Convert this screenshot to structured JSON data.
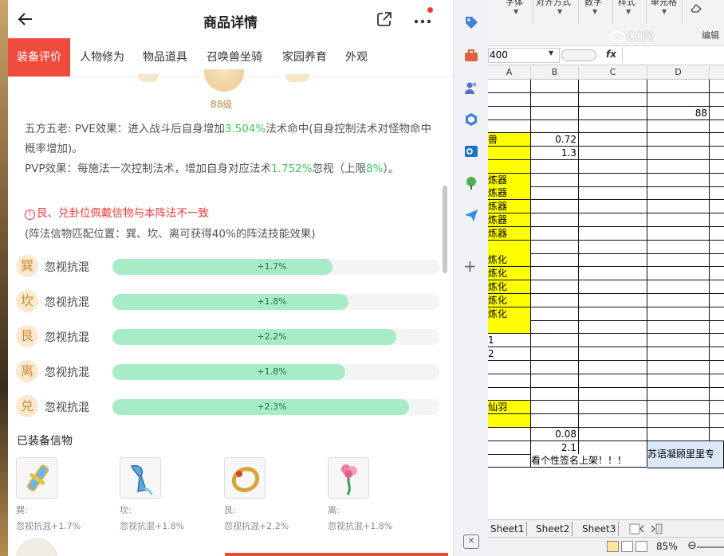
{
  "phone": {
    "title": "商品详情",
    "tabs": [
      {
        "label": "装备评价",
        "active": true
      },
      {
        "label": "人物修为",
        "active": false
      },
      {
        "label": "物品道具",
        "active": false
      },
      {
        "label": "召唤兽坐骑",
        "active": false
      },
      {
        "label": "家园养育",
        "active": false
      },
      {
        "label": "外观",
        "active": false
      }
    ],
    "level": "88级",
    "desc": {
      "line1_pre": "五方五老: PVE效果：进入战斗后自身增加",
      "line1_val": "3.504%",
      "line1_post": "法术命中(自身控制法术对怪物命中概率增加)。",
      "line2_pre": "PVP效果：每施法一次控制法术，增加自身对应法术",
      "line2_val": "1.752%",
      "line2_mid": "忽视（上限",
      "line2_val2": "8%",
      "line2_post": "）。"
    },
    "warning": "艮、兑卦位佩戴信物与本阵法不一致",
    "note": "(阵法信物匹配位置：巽、坎、离可获得40%的阵法技能效果)",
    "stats": [
      {
        "badge": "巽",
        "label": "忽视抗混",
        "value": "+1.7%",
        "fill_pct": 69
      },
      {
        "badge": "坎",
        "label": "忽视抗混",
        "value": "+1.8%",
        "fill_pct": 74
      },
      {
        "badge": "艮",
        "label": "忽视抗混",
        "value": "+2.2%",
        "fill_pct": 89
      },
      {
        "badge": "离",
        "label": "忽视抗混",
        "value": "+1.8%",
        "fill_pct": 73
      },
      {
        "badge": "兑",
        "label": "忽视抗混",
        "value": "+2.3%",
        "fill_pct": 93
      }
    ],
    "equip_title": "已装备信物",
    "equipped": [
      {
        "pos": "巽:",
        "effect": "忽视抗混+1.7%",
        "icon": "blue-sword-icon"
      },
      {
        "pos": "坎:",
        "effect": "忽视抗混+1.8%",
        "icon": "water-vase-icon"
      },
      {
        "pos": "艮:",
        "effect": "忽视抗混+2.2%",
        "icon": "gold-ring-icon"
      },
      {
        "pos": "离:",
        "effect": "忽视抗混+1.8%",
        "icon": "pink-flower-icon"
      }
    ],
    "colors": {
      "accent": "#f04c3e",
      "green": "#3ec95c",
      "fill": "#a8ecc7"
    }
  },
  "excel": {
    "ribbon": [
      "字体",
      "对齐方式",
      "数字",
      "样式",
      "单元格"
    ],
    "edit_label": "编辑",
    "watermark": "CC网",
    "namebox": "400",
    "fx": "fx",
    "columns": [
      "A",
      "B",
      "C",
      "D"
    ],
    "cells": {
      "d_row3": "88",
      "a_row5": "兽",
      "b_row5": "0.72",
      "b_row6": "1.3",
      "a_lianqi": [
        "炼器",
        "炼器",
        "炼器",
        "炼器",
        "炼器"
      ],
      "a_lianhua": [
        "炼化",
        "炼化",
        "炼化",
        "炼化",
        "炼化"
      ],
      "a_row20": "1",
      "a_row21": "2",
      "a_row25": "仙羽",
      "b_row27": "0.08",
      "b_row28": "2.1",
      "d_row28": "苏语凝顾里里专",
      "b_row29": "看个性签名上架！！！"
    },
    "sheets": [
      "Sheet1",
      "Sheet2",
      "Sheet3"
    ],
    "zoom": "85%"
  }
}
